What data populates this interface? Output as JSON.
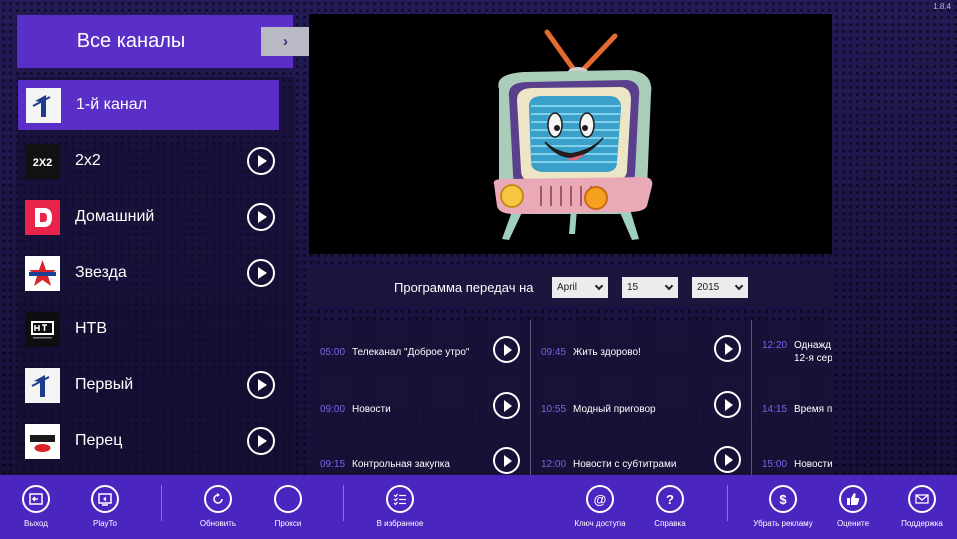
{
  "version": "1.8.4",
  "header": {
    "all_channels_label": "Все каналы",
    "arrow": "›"
  },
  "channels": [
    {
      "name": "1-й канал",
      "icon": "channel-one-logo",
      "selected": true
    },
    {
      "name": "2x2",
      "icon": "2x2-logo"
    },
    {
      "name": "Домашний",
      "icon": "domashniy-logo"
    },
    {
      "name": "Звезда",
      "icon": "zvezda-logo"
    },
    {
      "name": "НТВ",
      "icon": "ntv-logo"
    },
    {
      "name": "Первый",
      "icon": "pervyy-logo"
    },
    {
      "name": "Перец",
      "icon": "perets-logo"
    }
  ],
  "schedule": {
    "label": "Программа передач на",
    "month": "April",
    "day": "15",
    "year": "2015",
    "columns": [
      [
        {
          "time": "05:00",
          "title": "Телеканал \"Доброе утро\""
        },
        {
          "time": "09:00",
          "title": "Новости"
        },
        {
          "time": "09:15",
          "title": "Контрольная закупка"
        }
      ],
      [
        {
          "time": "09:45",
          "title": "Жить здорово!"
        },
        {
          "time": "10:55",
          "title": "Модный приговор"
        },
        {
          "time": "12:00",
          "title": "Новости с субтитрами"
        }
      ],
      [
        {
          "time": "12:20",
          "title": "Однажд",
          "title2": "12-я сер"
        },
        {
          "time": "14:15",
          "title": "Время п"
        },
        {
          "time": "15:00",
          "title": "Новости"
        }
      ]
    ]
  },
  "appbar": {
    "exit": "Выход",
    "playto": "PlayTo",
    "refresh": "Обновить",
    "proxy": "Прокси",
    "favorites": "В избранное",
    "access_key": "Ключ доступа",
    "help": "Справка",
    "remove_ads": "Убрать рекламу",
    "rate": "Оцените",
    "support": "Поддержка"
  },
  "colors": {
    "accent": "#5a2fc7",
    "appbar": "#4a25c0",
    "time": "#7b63e6"
  }
}
